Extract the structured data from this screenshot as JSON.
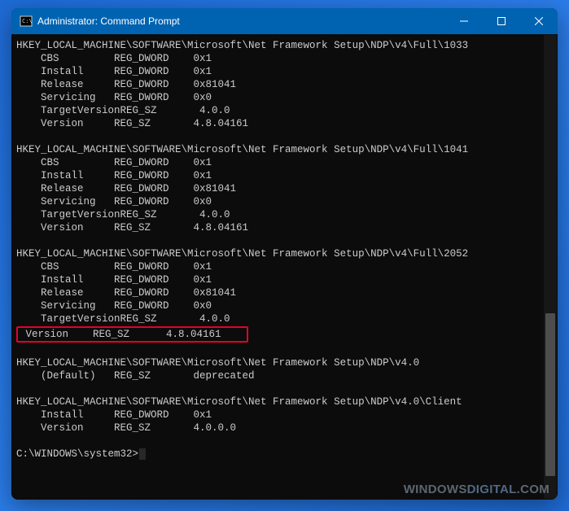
{
  "window": {
    "title": "Administrator: Command Prompt"
  },
  "registry": [
    {
      "key": "HKEY_LOCAL_MACHINE\\SOFTWARE\\Microsoft\\Net Framework Setup\\NDP\\v4\\Full\\1033",
      "values": [
        {
          "name": "CBS",
          "type": "REG_DWORD",
          "data": "0x1"
        },
        {
          "name": "Install",
          "type": "REG_DWORD",
          "data": "0x1"
        },
        {
          "name": "Release",
          "type": "REG_DWORD",
          "data": "0x81041"
        },
        {
          "name": "Servicing",
          "type": "REG_DWORD",
          "data": "0x0"
        },
        {
          "name": "TargetVersion",
          "type": "REG_SZ",
          "data": "4.0.0"
        },
        {
          "name": "Version",
          "type": "REG_SZ",
          "data": "4.8.04161"
        }
      ]
    },
    {
      "key": "HKEY_LOCAL_MACHINE\\SOFTWARE\\Microsoft\\Net Framework Setup\\NDP\\v4\\Full\\1041",
      "values": [
        {
          "name": "CBS",
          "type": "REG_DWORD",
          "data": "0x1"
        },
        {
          "name": "Install",
          "type": "REG_DWORD",
          "data": "0x1"
        },
        {
          "name": "Release",
          "type": "REG_DWORD",
          "data": "0x81041"
        },
        {
          "name": "Servicing",
          "type": "REG_DWORD",
          "data": "0x0"
        },
        {
          "name": "TargetVersion",
          "type": "REG_SZ",
          "data": "4.0.0"
        },
        {
          "name": "Version",
          "type": "REG_SZ",
          "data": "4.8.04161"
        }
      ]
    },
    {
      "key": "HKEY_LOCAL_MACHINE\\SOFTWARE\\Microsoft\\Net Framework Setup\\NDP\\v4\\Full\\2052",
      "values": [
        {
          "name": "CBS",
          "type": "REG_DWORD",
          "data": "0x1"
        },
        {
          "name": "Install",
          "type": "REG_DWORD",
          "data": "0x1"
        },
        {
          "name": "Release",
          "type": "REG_DWORD",
          "data": "0x81041"
        },
        {
          "name": "Servicing",
          "type": "REG_DWORD",
          "data": "0x0"
        },
        {
          "name": "TargetVersion",
          "type": "REG_SZ",
          "data": "4.0.0"
        },
        {
          "name": "Version",
          "type": "REG_SZ",
          "data": "4.8.04161",
          "highlight": true
        }
      ]
    },
    {
      "key": "HKEY_LOCAL_MACHINE\\SOFTWARE\\Microsoft\\Net Framework Setup\\NDP\\v4.0",
      "values": [
        {
          "name": "(Default)",
          "type": "REG_SZ",
          "data": "deprecated"
        }
      ]
    },
    {
      "key": "HKEY_LOCAL_MACHINE\\SOFTWARE\\Microsoft\\Net Framework Setup\\NDP\\v4.0\\Client",
      "values": [
        {
          "name": "Install",
          "type": "REG_DWORD",
          "data": "0x1"
        },
        {
          "name": "Version",
          "type": "REG_SZ",
          "data": "4.0.0.0"
        }
      ]
    }
  ],
  "prompt": "C:\\WINDOWS\\system32>",
  "watermark": {
    "text1": "WINDOWS",
    "text2": "DIGITAL",
    "text3": ".COM"
  }
}
